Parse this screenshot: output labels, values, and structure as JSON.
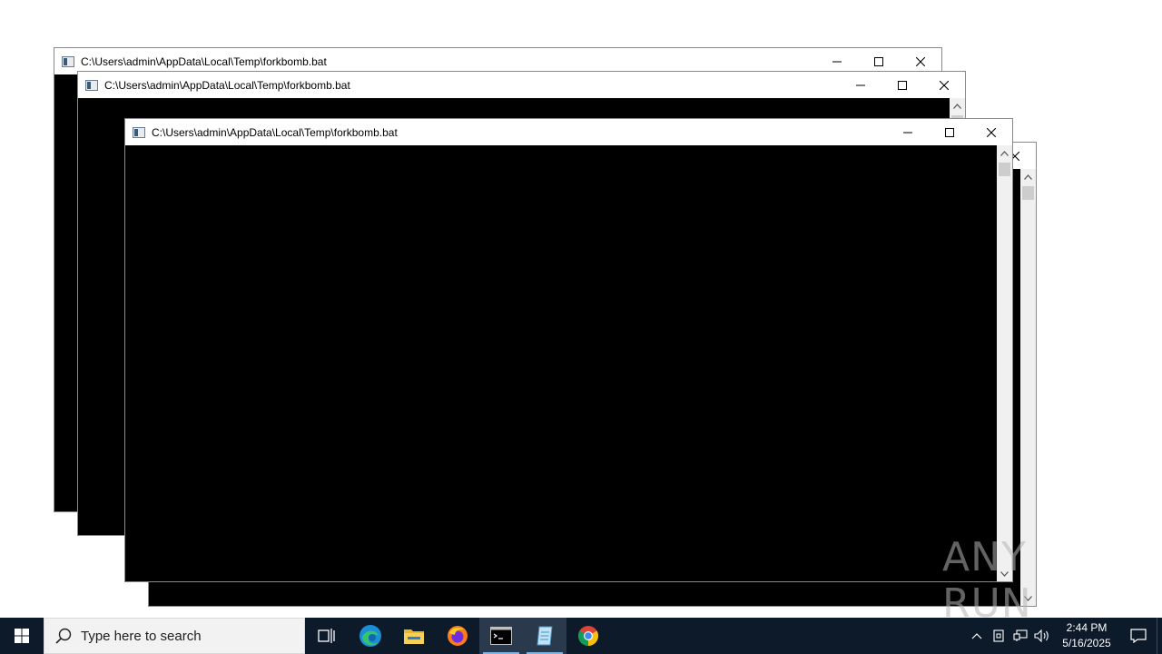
{
  "windows": [
    {
      "title": "C:\\Users\\admin\\AppData\\Local\\Temp\\forkbomb.bat"
    },
    {
      "title": "C:\\Users\\admin\\AppData\\Local\\Temp\\forkbomb.bat"
    },
    {
      "title": "C:\\Users\\admin\\AppData\\Local\\Temp\\forkbomb.bat"
    }
  ],
  "taskbar": {
    "search_placeholder": "Type here to search",
    "apps": [
      "task-view",
      "edge",
      "file-explorer",
      "firefox",
      "command-prompt",
      "notepad",
      "chrome"
    ],
    "clock_time": "2:44 PM",
    "clock_date": "5/16/2025"
  },
  "watermark": "ANY RUN"
}
